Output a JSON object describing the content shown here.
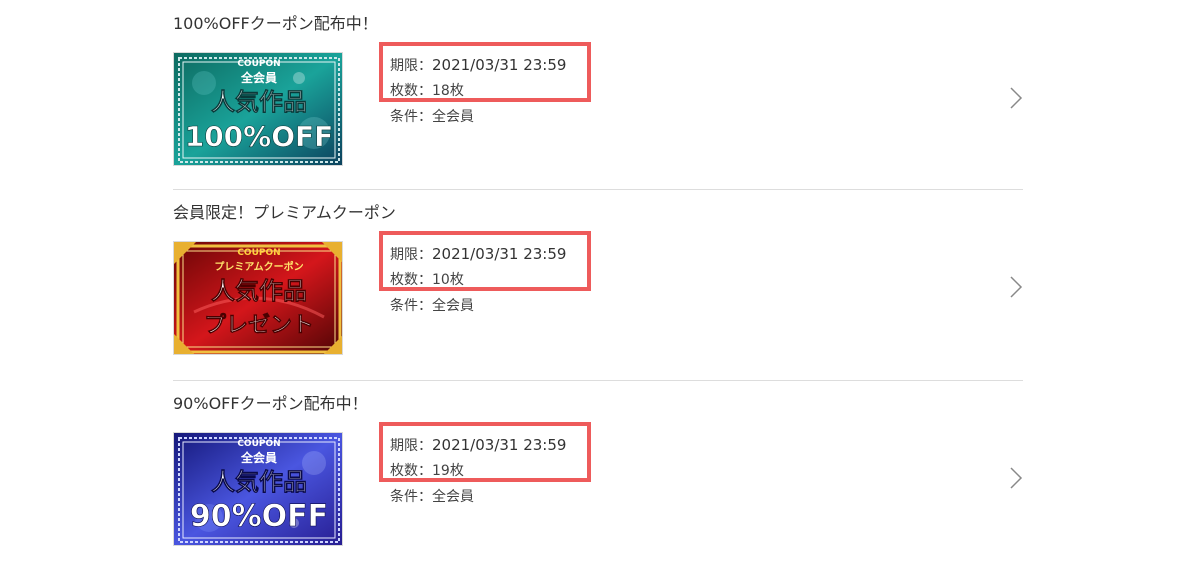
{
  "coupons": [
    {
      "title": "100%OFFクーポン配布中！",
      "banner": {
        "tag": "COUPON",
        "line1": "全会員",
        "line2": "人気作品",
        "line3": "100%OFF",
        "theme": "teal",
        "colors": [
          "#0b5e5a",
          "#1aa39a",
          "#0b4a62"
        ]
      },
      "expiry_label": "期限：",
      "expiry_value": "2021/03/31 23:59",
      "count_label": "枚数：",
      "count_value": "18枚",
      "condition_label": "条件：",
      "condition_value": "全会員",
      "chevron_icon": "chevron-right-icon"
    },
    {
      "title": "会員限定！プレミアムクーポン",
      "banner": {
        "tag": "COUPON",
        "line1": "プレミアムクーポン",
        "line2": "人気作品",
        "line3": "プレゼント",
        "theme": "red",
        "colors": [
          "#8b0a0a",
          "#d4161b",
          "#5a0505"
        ]
      },
      "expiry_label": "期限：",
      "expiry_value": "2021/03/31 23:59",
      "count_label": "枚数：",
      "count_value": "10枚",
      "condition_label": "条件：",
      "condition_value": "全会員",
      "chevron_icon": "chevron-right-icon"
    },
    {
      "title": "90%OFFクーポン配布中！",
      "banner": {
        "tag": "COUPON",
        "line1": "全会員",
        "line2": "人気作品",
        "line3": "90%OFF",
        "theme": "blue",
        "colors": [
          "#1a1f8f",
          "#4a56e0",
          "#2a2fa8"
        ]
      },
      "expiry_label": "期限：",
      "expiry_value": "2021/03/31 23:59",
      "count_label": "枚数：",
      "count_value": "19枚",
      "condition_label": "条件：",
      "condition_value": "全会員",
      "chevron_icon": "chevron-right-icon"
    }
  ],
  "highlight_color": "#ee5b5b"
}
